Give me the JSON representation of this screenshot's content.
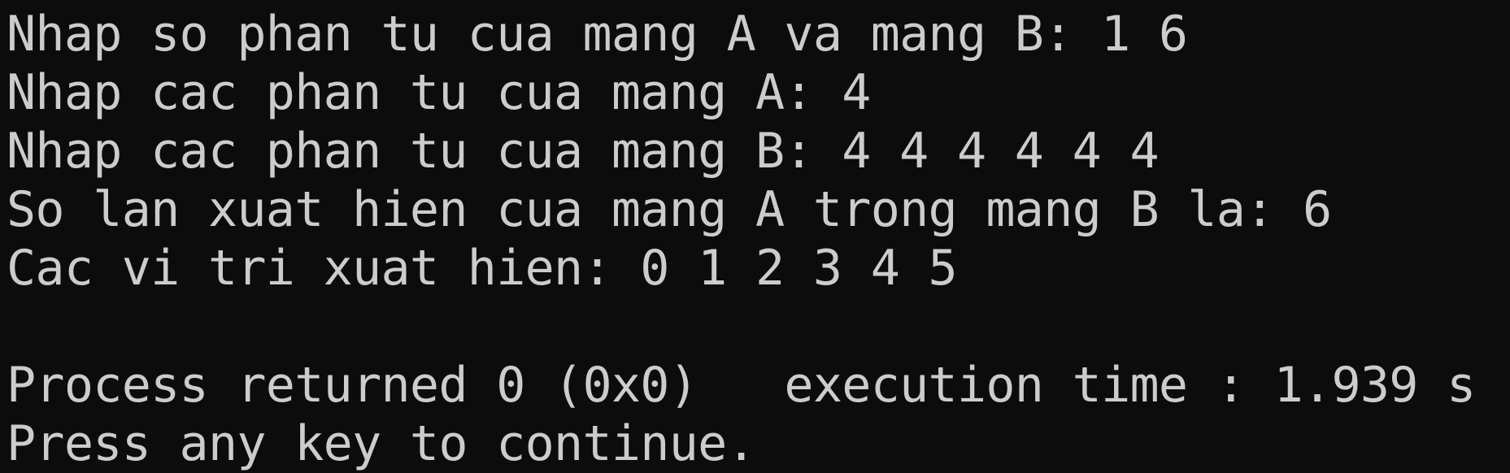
{
  "console": {
    "lines": [
      "Nhap so phan tu cua mang A va mang B: 1 6",
      "Nhap cac phan tu cua mang A: 4",
      "Nhap cac phan tu cua mang B: 4 4 4 4 4 4",
      "So lan xuat hien cua mang A trong mang B la: 6",
      "Cac vi tri xuat hien: 0 1 2 3 4 5",
      "",
      "Process returned 0 (0x0)   execution time : 1.939 s",
      "Press any key to continue."
    ]
  }
}
